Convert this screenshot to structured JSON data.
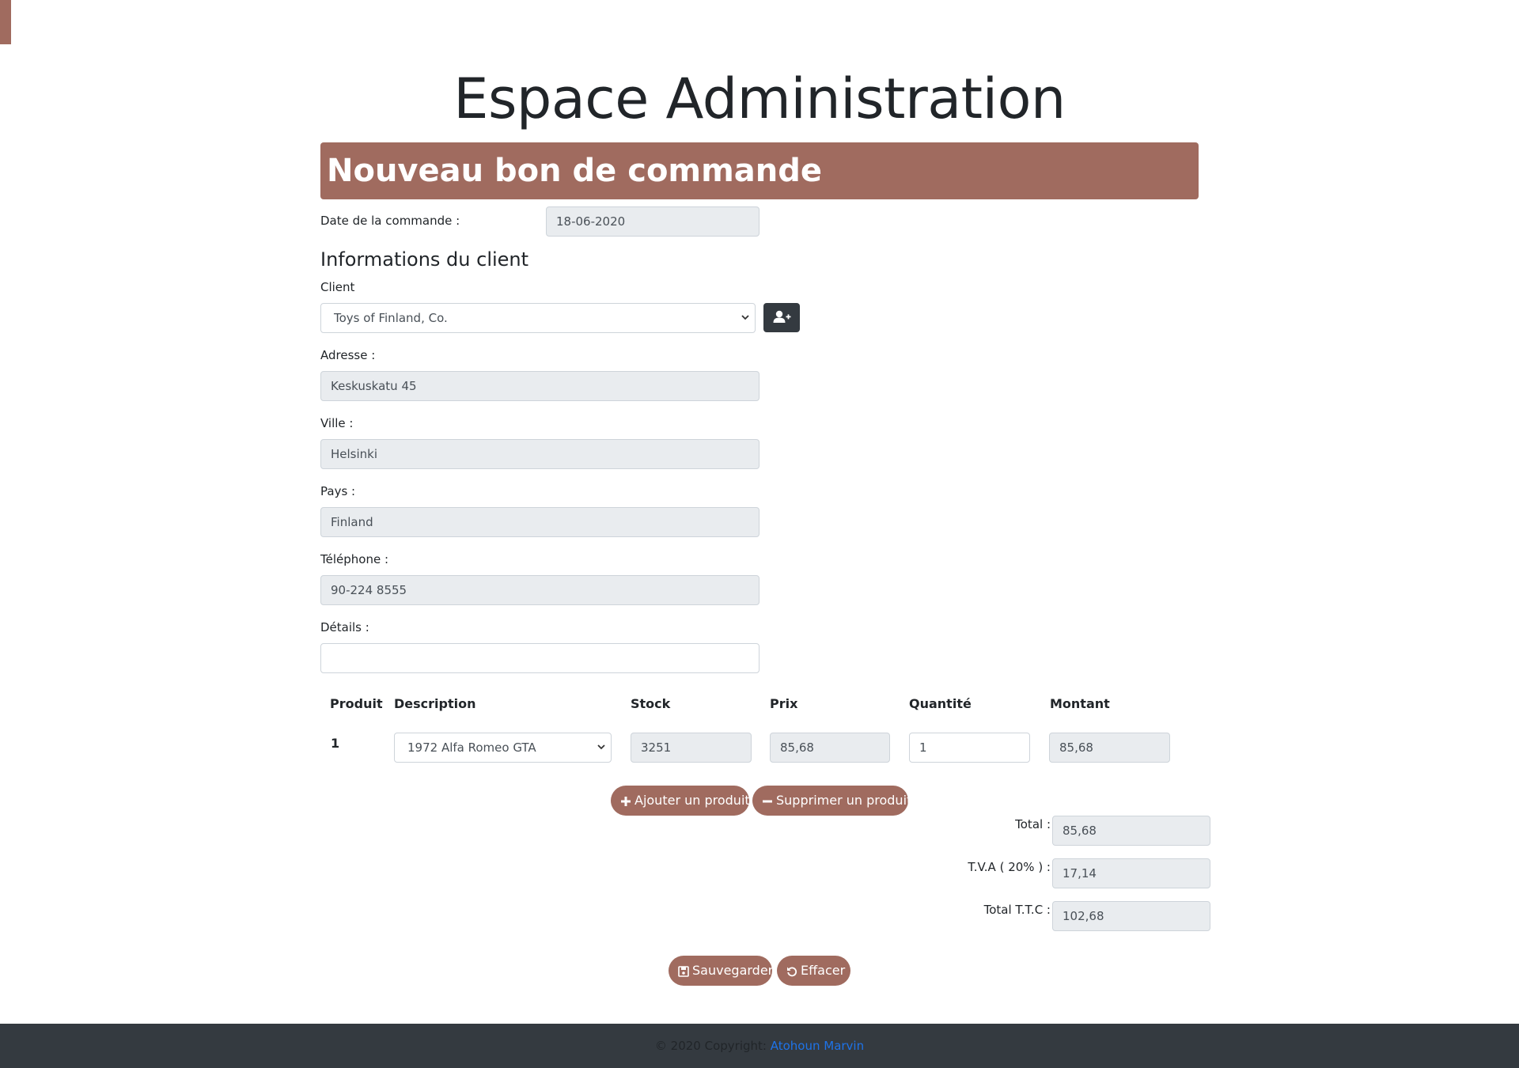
{
  "page": {
    "title": "Espace Administration",
    "banner": "Nouveau bon de commande"
  },
  "order": {
    "date_label": "Date de la commande :",
    "date_value": "18-06-2020"
  },
  "client": {
    "section_title": "Informations du client",
    "client_label": "Client",
    "client_selected": "Toys of Finland, Co.",
    "add_client_icon": "user-plus-icon",
    "address_label": "Adresse :",
    "address_value": "Keskuskatu 45",
    "city_label": "Ville :",
    "city_value": "Helsinki",
    "country_label": "Pays :",
    "country_value": "Finland",
    "phone_label": "Téléphone :",
    "phone_value": "90-224 8555",
    "details_label": "Détails :",
    "details_value": ""
  },
  "products": {
    "headers": [
      "Produit",
      "Description",
      "Stock",
      "Prix",
      "Quantité",
      "Montant"
    ],
    "rows": [
      {
        "num": "1",
        "description": "1972 Alfa Romeo GTA",
        "stock": "3251",
        "price": "85,68",
        "quantity": "1",
        "amount": "85,68"
      }
    ],
    "add_label": "Ajouter un produit",
    "remove_label": "Supprimer un produit"
  },
  "totals": {
    "total_label": "Total :",
    "total_value": "85,68",
    "tva_label": "T.V.A ( 20% ) :",
    "tva_value": "17,14",
    "ttc_label": "Total T.T.C :",
    "ttc_value": "102,68"
  },
  "actions": {
    "save_label": "Sauvegarder",
    "clear_label": "Effacer"
  },
  "footer": {
    "copyright": "© 2020 Copyright:",
    "author": "Atohoun Marvin"
  },
  "colors": {
    "accent": "#a06b5f",
    "dark": "#343a40",
    "link": "#1e73e8",
    "readonly_bg": "#e9ecef"
  }
}
